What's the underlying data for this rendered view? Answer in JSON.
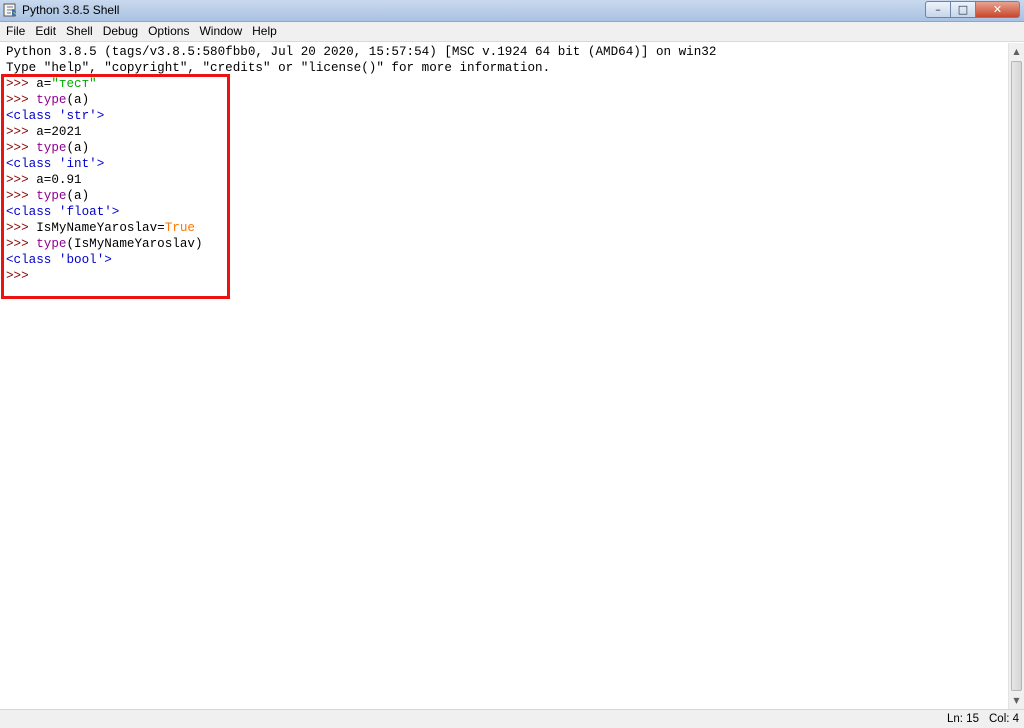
{
  "window": {
    "title": "Python 3.8.5 Shell",
    "buttons": {
      "minimize": "–",
      "maximize": "□",
      "close": "✕"
    }
  },
  "menu": [
    "File",
    "Edit",
    "Shell",
    "Debug",
    "Options",
    "Window",
    "Help"
  ],
  "shell": {
    "banner": [
      "Python 3.8.5 (tags/v3.8.5:580fbb0, Jul 20 2020, 15:57:54) [MSC v.1924 64 bit (AMD64)] on win32",
      "Type \"help\", \"copyright\", \"credits\" or \"license()\" for more information."
    ],
    "prompt": ">>> ",
    "lines": [
      {
        "kind": "input",
        "parts": [
          {
            "t": "a=",
            "c": "plain"
          },
          {
            "t": "\"тест\"",
            "c": "str"
          }
        ]
      },
      {
        "kind": "input",
        "parts": [
          {
            "t": "type",
            "c": "builtin"
          },
          {
            "t": "(a)",
            "c": "plain"
          }
        ]
      },
      {
        "kind": "output",
        "parts": [
          {
            "t": "<class 'str'>",
            "c": "out"
          }
        ]
      },
      {
        "kind": "input",
        "parts": [
          {
            "t": "a=2021",
            "c": "plain"
          }
        ]
      },
      {
        "kind": "input",
        "parts": [
          {
            "t": "type",
            "c": "builtin"
          },
          {
            "t": "(a)",
            "c": "plain"
          }
        ]
      },
      {
        "kind": "output",
        "parts": [
          {
            "t": "<class 'int'>",
            "c": "out"
          }
        ]
      },
      {
        "kind": "input",
        "parts": [
          {
            "t": "a=0.91",
            "c": "plain"
          }
        ]
      },
      {
        "kind": "input",
        "parts": [
          {
            "t": "type",
            "c": "builtin"
          },
          {
            "t": "(a)",
            "c": "plain"
          }
        ]
      },
      {
        "kind": "output",
        "parts": [
          {
            "t": "<class 'float'>",
            "c": "out"
          }
        ]
      },
      {
        "kind": "input",
        "parts": [
          {
            "t": "IsMyNameYaroslav=",
            "c": "plain"
          },
          {
            "t": "True",
            "c": "kw"
          }
        ]
      },
      {
        "kind": "input",
        "parts": [
          {
            "t": "type",
            "c": "builtin"
          },
          {
            "t": "(IsMyNameYaroslav)",
            "c": "plain"
          }
        ]
      },
      {
        "kind": "output",
        "parts": [
          {
            "t": "<class 'bool'>",
            "c": "out"
          }
        ]
      },
      {
        "kind": "input",
        "parts": []
      }
    ]
  },
  "status": {
    "line": "Ln: 15",
    "col": "Col: 4"
  },
  "colors": {
    "prompt": "#8b0000",
    "output": "#0000cc",
    "builtin": "#900090",
    "string": "#00aa00",
    "keyword": "#ff7700",
    "highlight_box": "#ee1111"
  },
  "icons": {
    "app": "python-idle-icon",
    "scroll_up": "arrow-up-icon",
    "scroll_down": "arrow-down-icon"
  }
}
